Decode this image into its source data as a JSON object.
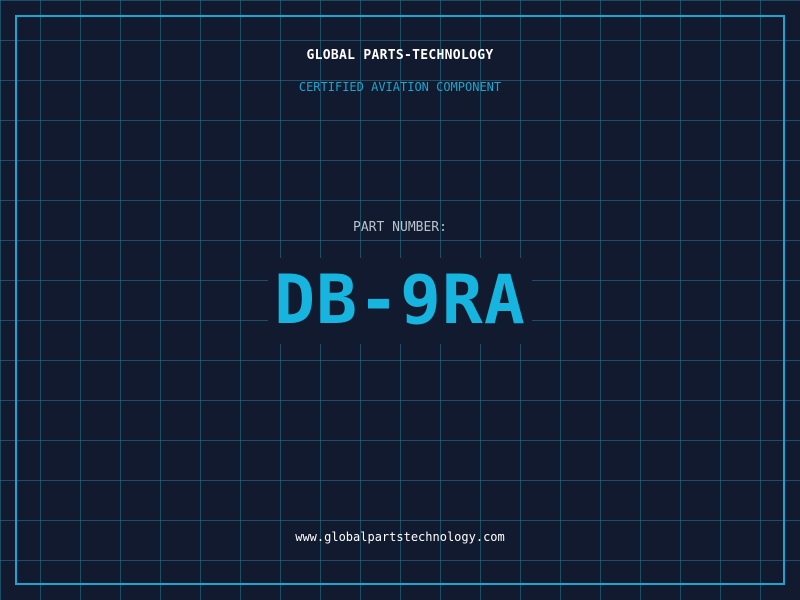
{
  "header": {
    "company": "GLOBAL PARTS-TECHNOLOGY",
    "tagline": "CERTIFIED AVIATION COMPONENT"
  },
  "part": {
    "label": "PART NUMBER:",
    "number": "DB-9RA"
  },
  "footer": {
    "url": "www.globalpartstechnology.com"
  },
  "colors": {
    "background": "#111a2e",
    "grid": "#26789a",
    "accent": "#1aa6d0",
    "part_number": "#16b4de",
    "text": "#ffffff",
    "muted_text": "#b9c2cf"
  }
}
